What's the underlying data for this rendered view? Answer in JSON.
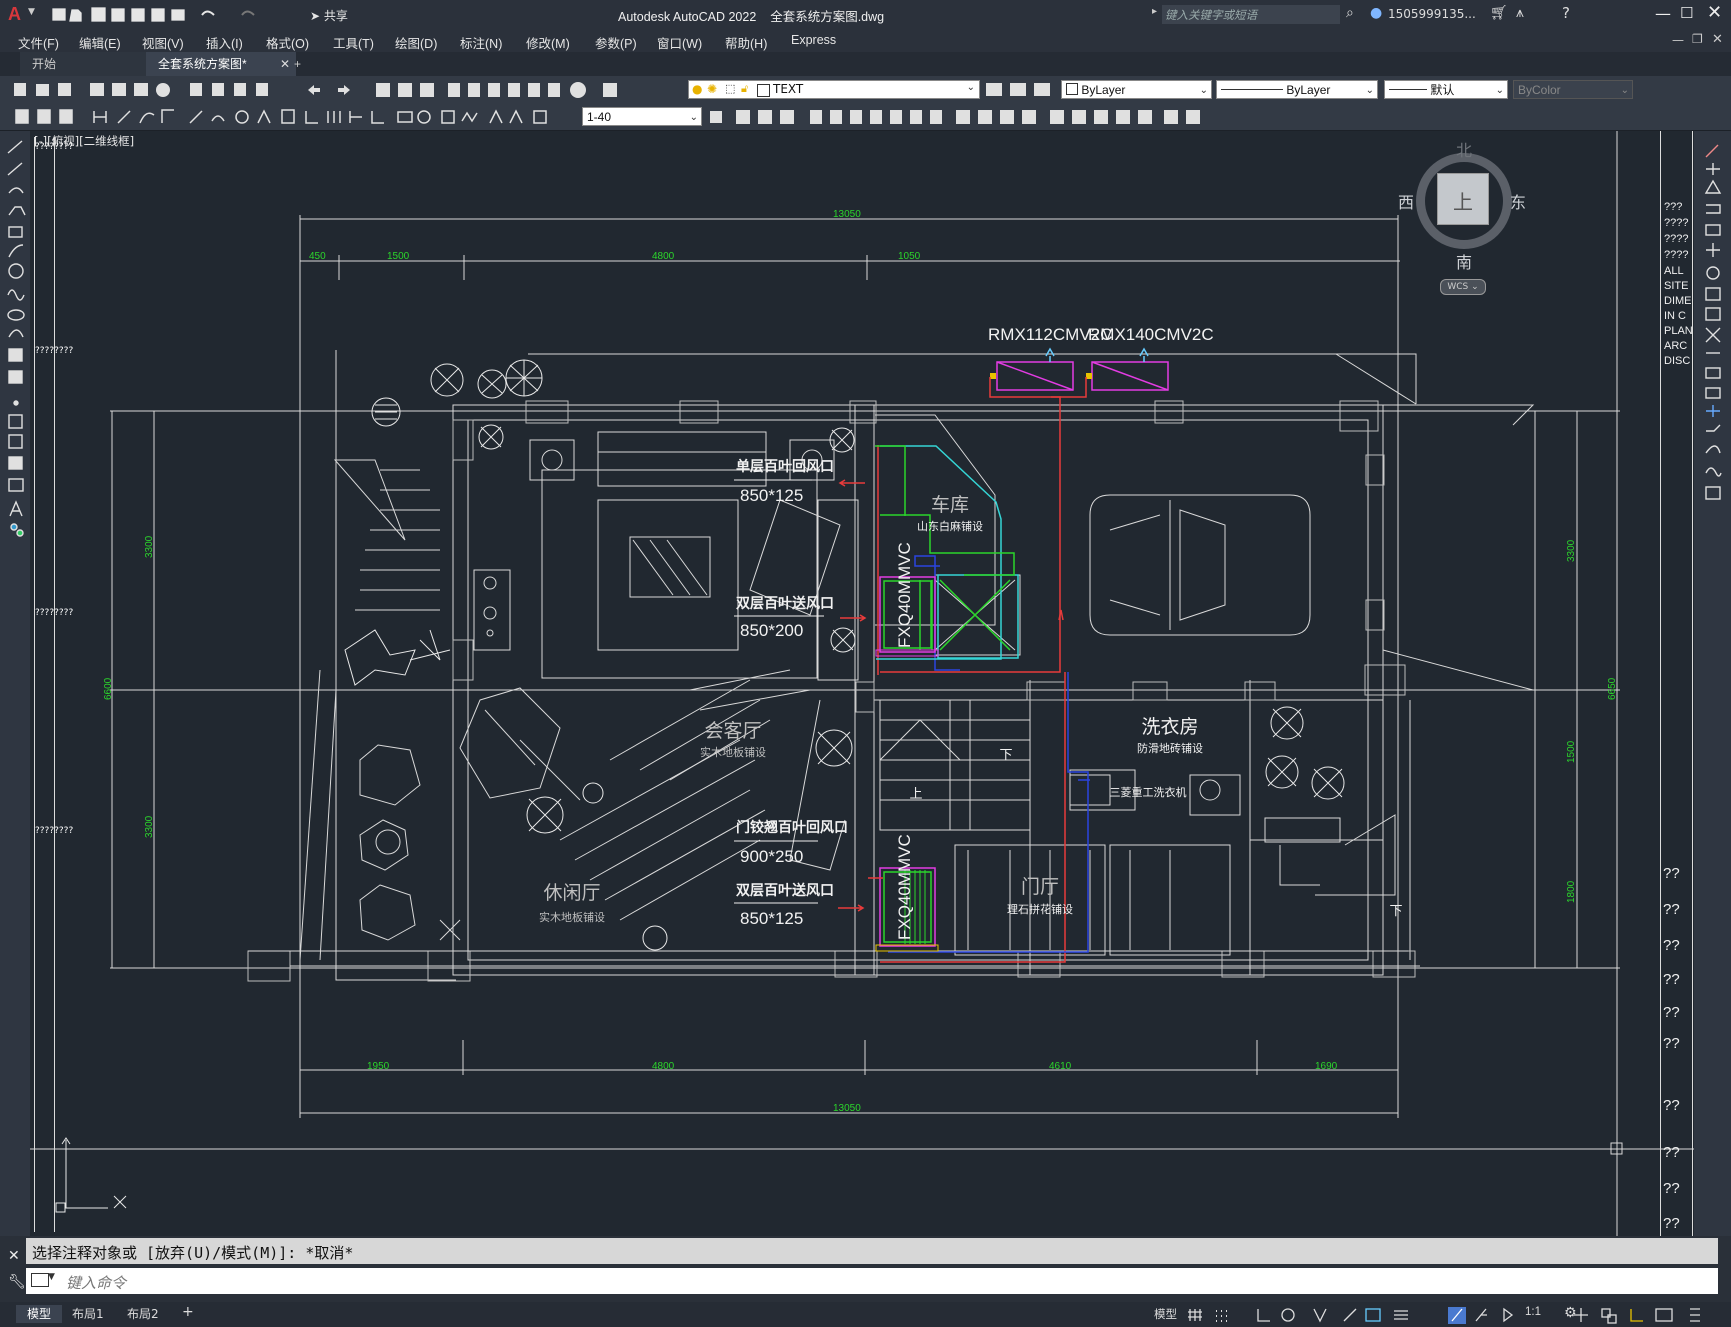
{
  "title": {
    "app": "Autodesk AutoCAD 2022",
    "file": "全套系统方案图.dwg",
    "search_placeholder": "键入关键字或短语",
    "user": "1505999135...",
    "share": "共享"
  },
  "menu": [
    "文件(F)",
    "编辑(E)",
    "视图(V)",
    "插入(I)",
    "格式(O)",
    "工具(T)",
    "绘图(D)",
    "标注(N)",
    "修改(M)",
    "参数(P)",
    "窗口(W)",
    "帮助(H)",
    "Express"
  ],
  "tabs": {
    "start": "开始",
    "drawing": "全套系统方案图*",
    "add": "+"
  },
  "toolbar": {
    "textstyle": "TEXT",
    "layer_color": "ByLayer",
    "linetype": "ByLayer",
    "lineweight": "默认",
    "plotstyle": "ByColor",
    "scale": "1-40"
  },
  "viewport_label": "[-][俯视][二维线框]",
  "viewcube": {
    "north": "北",
    "south": "南",
    "west": "西",
    "east": "东",
    "top": "上",
    "wcs": "WCS"
  },
  "drawing": {
    "dims_top": {
      "overall": "13050",
      "d1": "450",
      "d2": "1500",
      "d3": "4800",
      "d4": "1050"
    },
    "dims_bottom": {
      "overall": "13050",
      "d1": "1950",
      "d2": "4800",
      "d3": "4610",
      "d4": "1690"
    },
    "dims_left": {
      "a": "3300",
      "b": "6600",
      "c": "3300"
    },
    "dims_right": {
      "a": "3300",
      "b": "6650",
      "c": "1500",
      "d": "1800"
    },
    "units": [
      "RMX112CMV2C",
      "RMX140CMV2C"
    ],
    "fx_units": [
      "FXQ40MMVC",
      "FXQ40MMVC"
    ],
    "rooms": [
      {
        "name": "车库",
        "sub": "山东白麻铺设"
      },
      {
        "name": "会客厅",
        "sub": "实木地板铺设"
      },
      {
        "name": "休闲厅",
        "sub": "实木地板铺设"
      },
      {
        "name": "洗衣房",
        "sub": "防滑地砖铺设"
      },
      {
        "name": "门厅",
        "sub": "理石拼花铺设"
      }
    ],
    "vents": [
      {
        "name": "单层百叶回风口",
        "size": "850*125"
      },
      {
        "name": "双层百叶送风口",
        "size": "850*200"
      },
      {
        "name": "门铰翘百叶回风口",
        "size": "900*250"
      },
      {
        "name": "双层百叶送风口",
        "size": "850*125"
      }
    ],
    "misc": {
      "down": "下",
      "up": "上",
      "washer": "三菱重工洗衣机"
    }
  },
  "right_palette_texts": [
    "???",
    "????",
    "????",
    "????",
    "ALL",
    "SITE",
    "DIME",
    "IN C",
    "PLAN",
    "ARC",
    "DISC"
  ],
  "right_cells": [
    "??",
    "??",
    "??",
    "??",
    "??",
    "??",
    "??",
    "??",
    "??",
    "????",
    "??"
  ],
  "left_cells": [
    "????????",
    "????????",
    "????????",
    "????????"
  ],
  "command": {
    "history": "选择注释对象或 [放弃(U)/模式(M)]: *取消*",
    "placeholder": "键入命令"
  },
  "status": {
    "layout_tabs": [
      "模型",
      "布局1",
      "布局2"
    ],
    "model": "模型",
    "scale": "1:1"
  },
  "colors": {
    "accent": "#c83a3a",
    "bg": "#212830",
    "green": "#2bd62b",
    "magenta": "#e23ce2",
    "cyan": "#35d5d5"
  }
}
